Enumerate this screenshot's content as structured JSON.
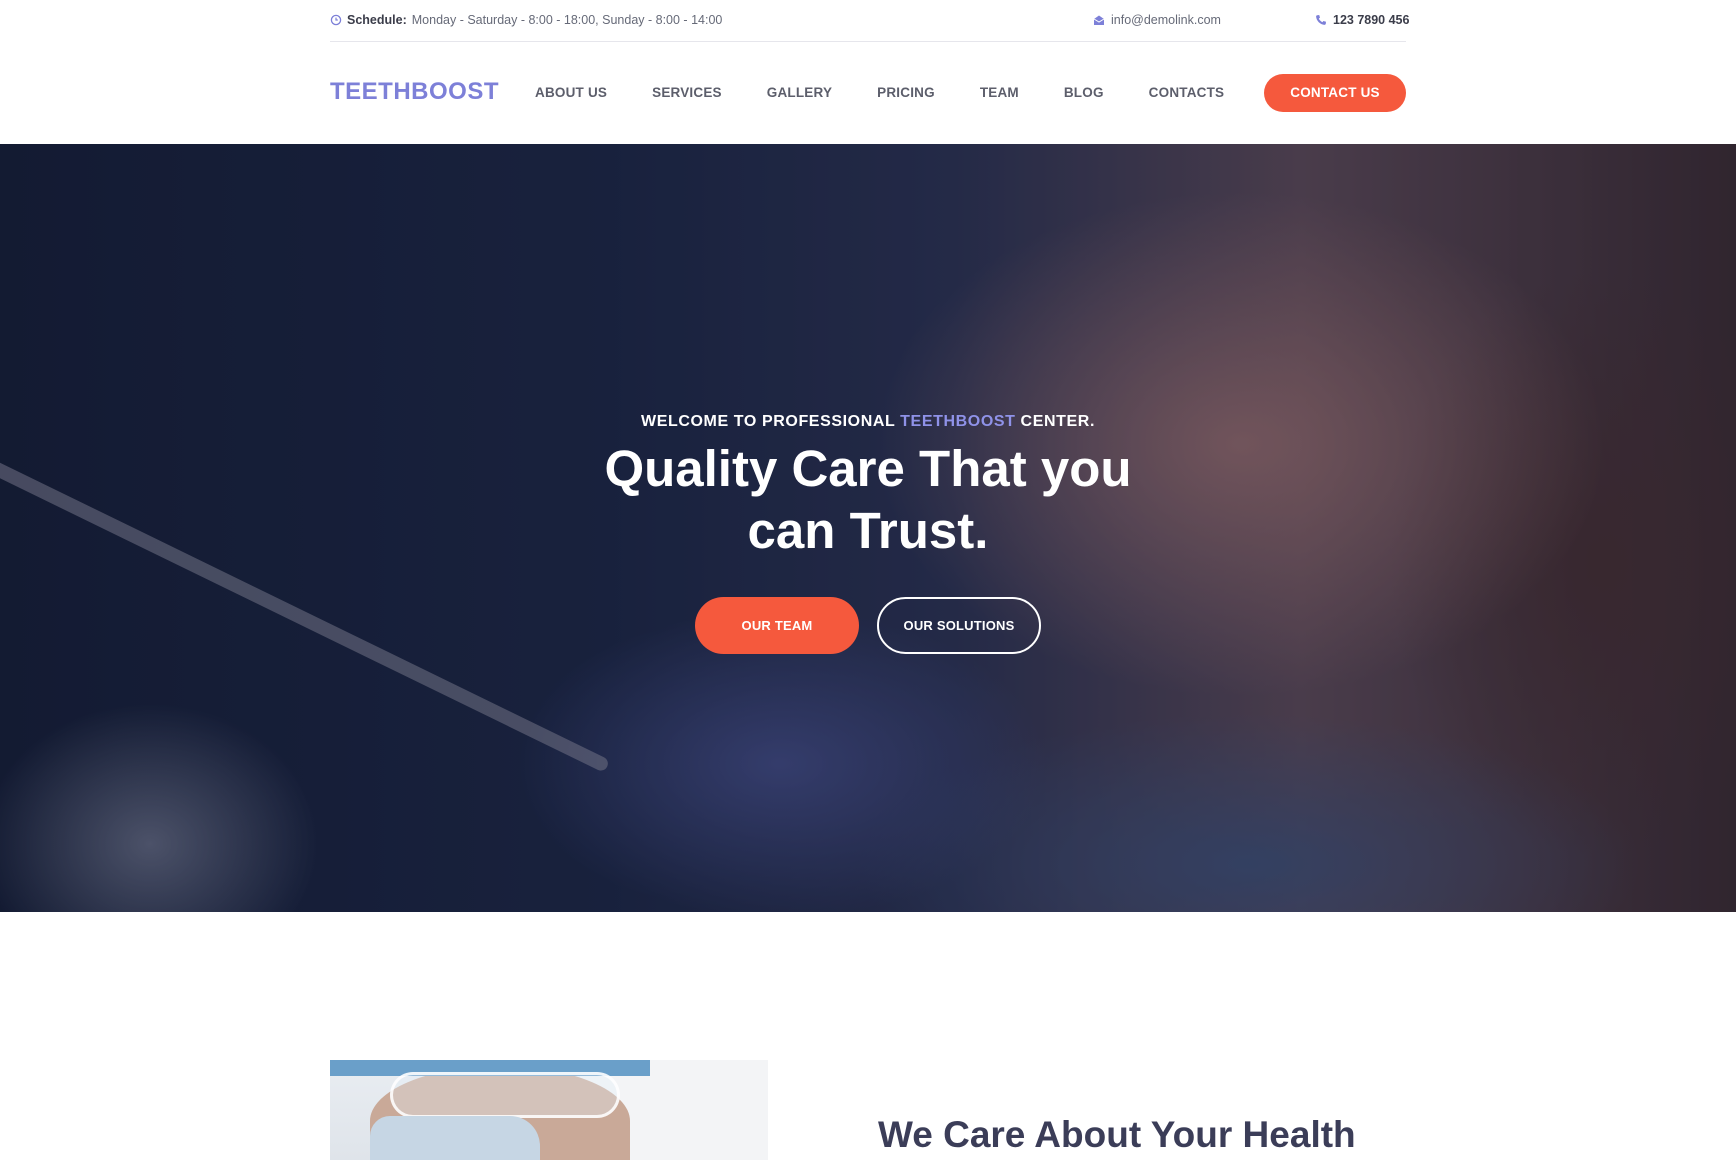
{
  "topbar": {
    "schedule_label": "Schedule:",
    "schedule_text": "Monday - Saturday - 8:00 - 18:00, Sunday - 8:00 - 14:00",
    "email": "info@demolink.com",
    "phone": "123 7890 456",
    "icons": {
      "schedule": "clock-icon",
      "email": "envelope-icon",
      "phone": "phone-icon"
    }
  },
  "nav": {
    "logo": "TEETHBOOST",
    "items": [
      "ABOUT US",
      "SERVICES",
      "GALLERY",
      "PRICING",
      "TEAM",
      "BLOG",
      "CONTACTS"
    ],
    "cta": "CONTACT US"
  },
  "hero": {
    "welcome_before": "WELCOME TO PROFESSIONAL ",
    "welcome_highlight": "TEETHBOOST",
    "welcome_after": " CENTER.",
    "title": "Quality Care That you can Trust.",
    "primary_button": "OUR TEAM",
    "secondary_button": "OUR SOLUTIONS"
  },
  "about": {
    "title": "We Care About Your Health"
  },
  "colors": {
    "accent": "#f5593d",
    "brand": "#7d80d8",
    "heading": "#3b3d58"
  }
}
